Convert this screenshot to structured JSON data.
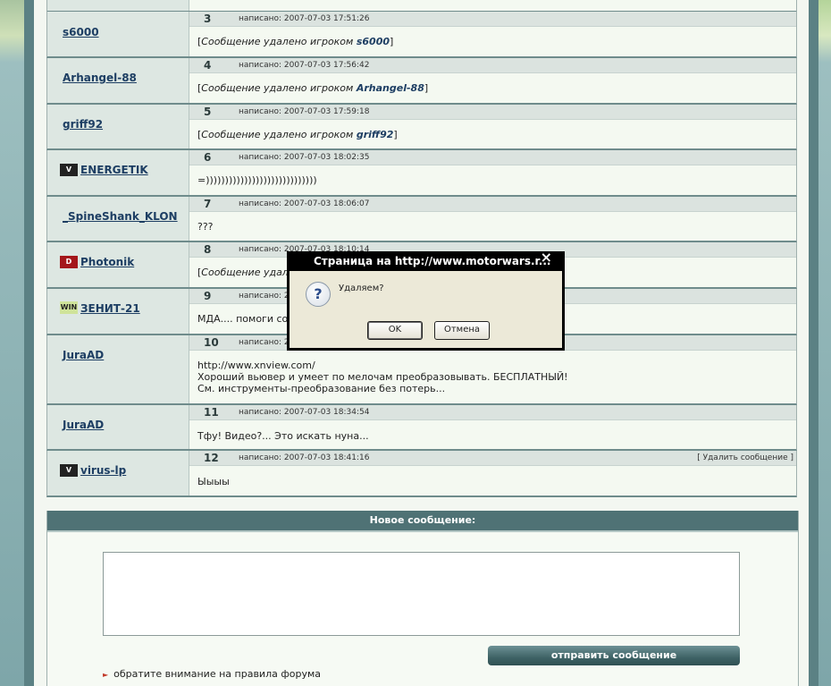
{
  "posts": [
    {
      "num": "3",
      "author": "s6000",
      "date": "написано: 2007-07-03 17:51:26",
      "body_prefix": "[",
      "body_deleted": "Сообщение удалено игроком ",
      "body_name": "s6000",
      "body_suffix": "]"
    },
    {
      "num": "4",
      "author": "Arhangel-88",
      "date": "написано: 2007-07-03 17:56:42",
      "body_prefix": "[",
      "body_deleted": "Сообщение удалено игроком ",
      "body_name": "Arhangel-88",
      "body_suffix": "]"
    },
    {
      "num": "5",
      "author": "griff92",
      "date": "написано: 2007-07-03 17:59:18",
      "body_prefix": "[",
      "body_deleted": "Сообщение удалено игроком ",
      "body_name": "griff92",
      "body_suffix": "]"
    },
    {
      "num": "6",
      "author": "ENERGETIK",
      "date": "написано: 2007-07-03 18:02:35",
      "body": "=)))))))))))))))))))))))))))))"
    },
    {
      "num": "7",
      "author": "_SpineShank_KLON",
      "date": "написано: 2007-07-03 18:06:07",
      "body": "???"
    },
    {
      "num": "8",
      "author": "Photonik",
      "date": "написано: 2007-07-03 18:10:14",
      "body_prefix": "[",
      "body_deleted": "Сообщение удале"
    },
    {
      "num": "9",
      "author": "ЗЕНИТ-21",
      "date": "написано: 2",
      "body": "МДА.... помоги сооб"
    },
    {
      "num": "10",
      "author": "JuraAD",
      "date": "написано: 2",
      "body_lines": [
        "http://www.xnview.com/",
        "Хороший вьювер и умеет по мелочам преобразовывать. БЕСПЛАТНЫЙ!",
        "См. инструменты-преобразование без потерь..."
      ]
    },
    {
      "num": "11",
      "author": "JuraAD",
      "date": "написано: 2007-07-03 18:34:54",
      "body": "Тфу! Видео?... Это искать нуна..."
    },
    {
      "num": "12",
      "author": "virus-lp",
      "date": "написано: 2007-07-03 18:41:16",
      "body": "Ыыыы",
      "delete_label": "[ Удалить сообщение ]"
    }
  ],
  "badges": {
    "energetik": "V",
    "photonik": "D",
    "zenit": "WIN",
    "virus": "V"
  },
  "new_message": {
    "title": "Новое сообщение:",
    "send_label": "отправить сообщение",
    "rules_prefix": "обратите внимание на ",
    "rules_link": "правила форума"
  },
  "dialog": {
    "title": "Страница на http://www.motorwars.r...",
    "message": "Удаляем?",
    "ok": "OK",
    "cancel": "Отмена",
    "close": "×"
  },
  "colors": {
    "accent": "#4f7275",
    "link": "#1d3e63"
  }
}
